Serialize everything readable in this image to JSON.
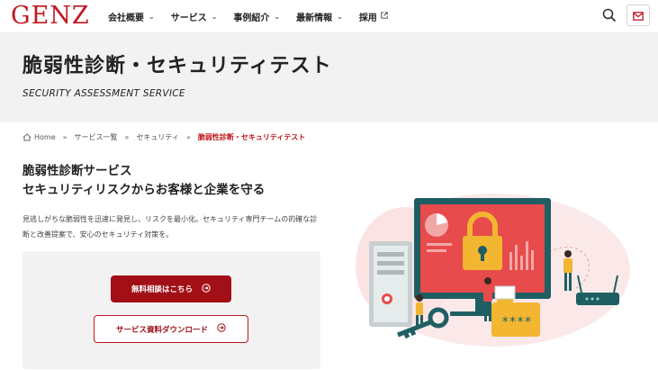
{
  "header": {
    "logo": "GENZ",
    "nav": [
      {
        "label": "会社概要",
        "type": "dropdown"
      },
      {
        "label": "サービス",
        "type": "dropdown"
      },
      {
        "label": "事例紹介",
        "type": "dropdown"
      },
      {
        "label": "最新情報",
        "type": "dropdown"
      },
      {
        "label": "採用",
        "type": "external"
      }
    ],
    "search_icon": "search-icon",
    "mail_icon": "mail-icon"
  },
  "hero": {
    "title": "脆弱性診断・セキュリティテスト",
    "subtitle": "SECURITY ASSESSMENT SERVICE"
  },
  "breadcrumb": {
    "home": "Home",
    "items": [
      "サービス一覧",
      "セキュリティ"
    ],
    "current": "脆弱性診断・セキュリティテスト",
    "separator": "»"
  },
  "main": {
    "heading_line1": "脆弱性診断サービス",
    "heading_line2": "セキュリティリスクからお客様と企業を守る",
    "description": "見逃しがちな脆弱性を迅速に発見し、リスクを最小化。セキュリティ専門チームの的確な診断と改善提案で、安心のセキュリティ対策を。",
    "primary_button": "無料相談はこちら",
    "secondary_button": "サービス資料ダウンロード"
  },
  "illustration": {
    "password_text": "****"
  },
  "colors": {
    "brand": "#c0171f",
    "button": "#a20f17",
    "hero_bg": "#f2f2f2",
    "teal": "#1f5f63",
    "screen": "#e84b4b",
    "lock": "#f2b631"
  }
}
